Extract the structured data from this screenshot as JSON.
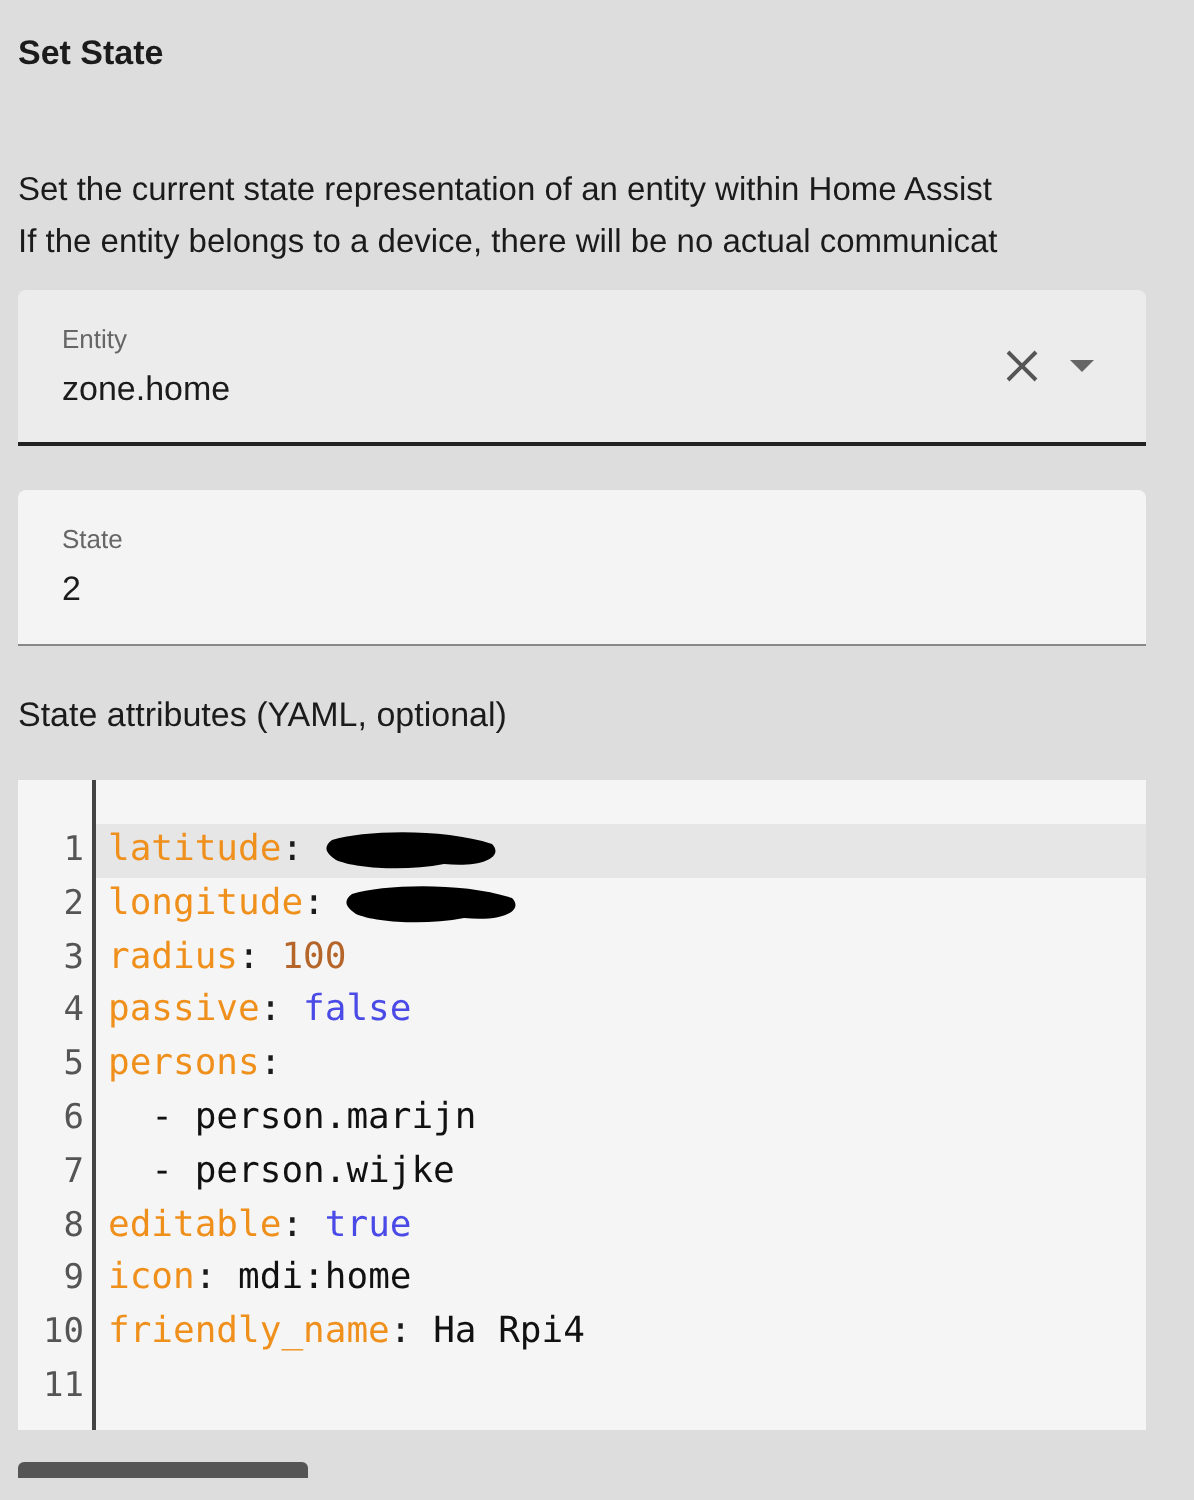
{
  "title": "Set State",
  "description": [
    "Set the current state representation of an entity within Home Assist",
    "If the entity belongs to a device, there will be no actual communicat"
  ],
  "entity_field": {
    "label": "Entity",
    "value": "zone.home"
  },
  "state_field": {
    "label": "State",
    "value": "2"
  },
  "attributes_label": "State attributes (YAML, optional)",
  "editor_lines": [
    {
      "number": "1",
      "key": "latitude",
      "separator": ":",
      "kind": "redacted",
      "selected": true
    },
    {
      "number": "2",
      "key": "longitude",
      "separator": ":",
      "kind": "redacted",
      "selected": false
    },
    {
      "number": "3",
      "key": "radius",
      "separator": ":",
      "kind": "number",
      "value": "100",
      "selected": false
    },
    {
      "number": "4",
      "key": "passive",
      "separator": ":",
      "kind": "bool",
      "value": "false",
      "selected": false
    },
    {
      "number": "5",
      "key": "persons",
      "separator": ":",
      "kind": "none",
      "selected": false
    },
    {
      "number": "6",
      "kind": "list_item",
      "value": "- person.marijn",
      "selected": false
    },
    {
      "number": "7",
      "kind": "list_item",
      "value": "- person.wijke",
      "selected": false
    },
    {
      "number": "8",
      "key": "editable",
      "separator": ":",
      "kind": "bool",
      "value": "true",
      "selected": false
    },
    {
      "number": "9",
      "key": "icon",
      "separator": ":",
      "kind": "plain",
      "value": "mdi:home",
      "selected": false
    },
    {
      "number": "10",
      "key": "friendly_name",
      "separator": ":",
      "kind": "plain",
      "value": "Ha Rpi4",
      "selected": false
    },
    {
      "number": "11",
      "kind": "empty",
      "selected": false
    }
  ]
}
